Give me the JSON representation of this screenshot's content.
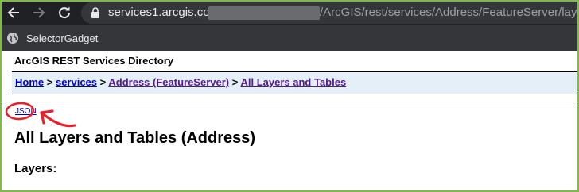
{
  "browser": {
    "url_host": "services1.arcgis.com",
    "url_path": "/ArcGIS/rest/services/Address/FeatureServer/layers",
    "bookmarks": [
      {
        "label": "SelectorGadget"
      }
    ]
  },
  "page": {
    "directory_title": "ArcGIS REST Services Directory",
    "breadcrumb": {
      "items": [
        "Home",
        "services",
        "Address (FeatureServer)",
        "All Layers and Tables"
      ],
      "separator": ">"
    },
    "json_link": "JSON",
    "heading": "All Layers and Tables (Address)",
    "layers_heading": "Layers:"
  },
  "colors": {
    "annotation": "#e8202a",
    "link": "#0000cc",
    "visited_link": "#551a8b",
    "breadcrumb_bg": "#e5eff7"
  }
}
